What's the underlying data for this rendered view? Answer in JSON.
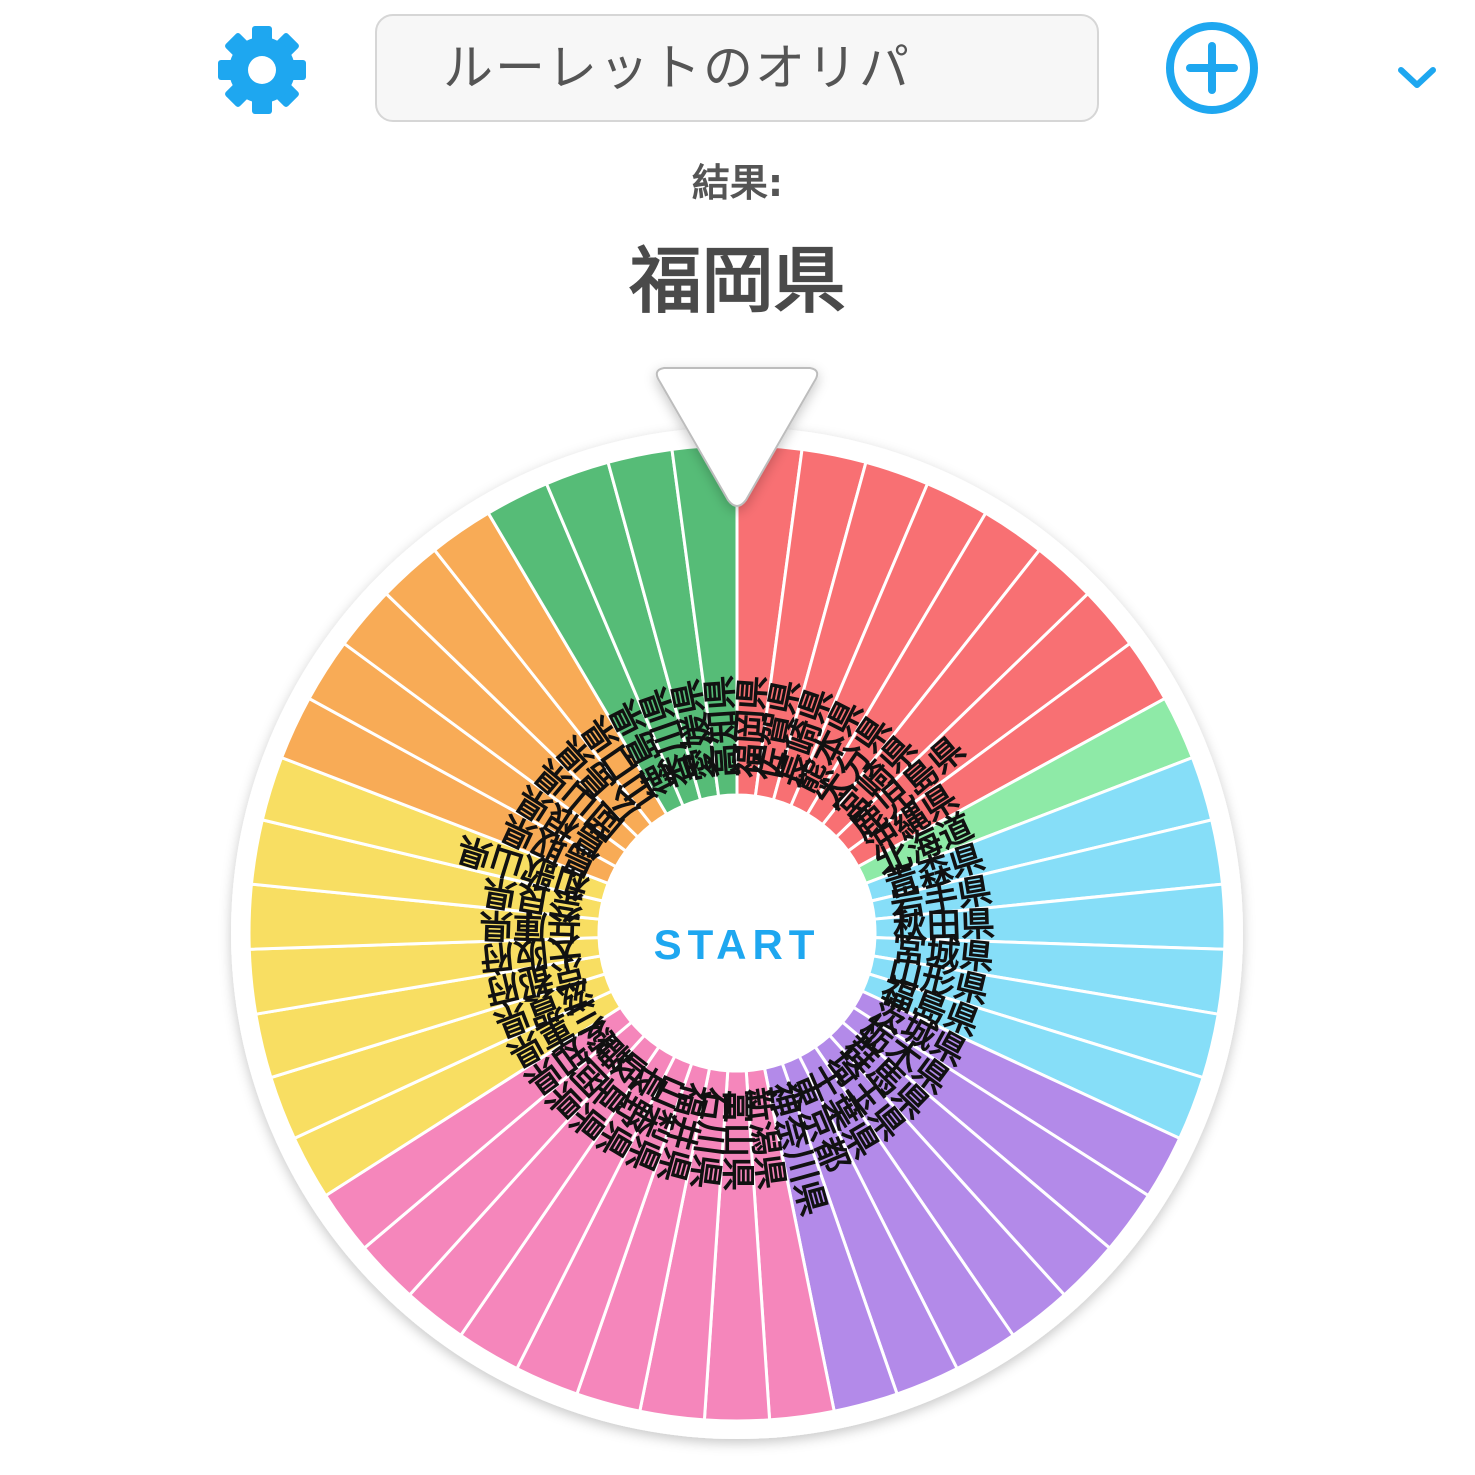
{
  "header": {
    "settings_icon": "gear-icon",
    "roulette_title": "ルーレットのオリパ",
    "dropdown_icon": "chevron-down-icon",
    "add_icon": "plus-circle-icon"
  },
  "result": {
    "label": "結果:",
    "value": "福岡県"
  },
  "wheel": {
    "start_label": "START",
    "pointer_icon": "triangle-pointer-icon",
    "colors": {
      "accent": "#1ea7f0",
      "red": "#f87073",
      "lightgreen": "#8eeaa7",
      "blue": "#86def8",
      "purple": "#b38ae9",
      "pink": "#f586bb",
      "yellow": "#f8de62",
      "orange": "#f8ab56",
      "green": "#56bc77"
    },
    "segments": [
      {
        "label": "福岡県",
        "color": "red"
      },
      {
        "label": "佐賀県",
        "color": "red"
      },
      {
        "label": "長崎県",
        "color": "red"
      },
      {
        "label": "熊本県",
        "color": "red"
      },
      {
        "label": "大分県",
        "color": "red"
      },
      {
        "label": "宮崎県",
        "color": "red"
      },
      {
        "label": "鹿児島県",
        "color": "red"
      },
      {
        "label": "沖縄県",
        "color": "red"
      },
      {
        "label": "北海道",
        "color": "lightgreen"
      },
      {
        "label": "青森県",
        "color": "blue"
      },
      {
        "label": "岩手県",
        "color": "blue"
      },
      {
        "label": "秋田県",
        "color": "blue"
      },
      {
        "label": "宮城県",
        "color": "blue"
      },
      {
        "label": "山形県",
        "color": "blue"
      },
      {
        "label": "福島県",
        "color": "blue"
      },
      {
        "label": "茨城県",
        "color": "purple"
      },
      {
        "label": "栃木県",
        "color": "purple"
      },
      {
        "label": "群馬県",
        "color": "purple"
      },
      {
        "label": "埼玉県",
        "color": "purple"
      },
      {
        "label": "千葉県",
        "color": "purple"
      },
      {
        "label": "東京都",
        "color": "purple"
      },
      {
        "label": "神奈川県",
        "color": "purple"
      },
      {
        "label": "新潟県",
        "color": "pink"
      },
      {
        "label": "富山県",
        "color": "pink"
      },
      {
        "label": "石川県",
        "color": "pink"
      },
      {
        "label": "福井県",
        "color": "pink"
      },
      {
        "label": "山梨県",
        "color": "pink"
      },
      {
        "label": "長野県",
        "color": "pink"
      },
      {
        "label": "岐阜県",
        "color": "pink"
      },
      {
        "label": "静岡県",
        "color": "pink"
      },
      {
        "label": "愛知県",
        "color": "pink"
      },
      {
        "label": "三重県",
        "color": "yellow"
      },
      {
        "label": "滋賀県",
        "color": "yellow"
      },
      {
        "label": "京都府",
        "color": "yellow"
      },
      {
        "label": "大阪府",
        "color": "yellow"
      },
      {
        "label": "兵庫県",
        "color": "yellow"
      },
      {
        "label": "奈良県",
        "color": "yellow"
      },
      {
        "label": "和歌山県",
        "color": "yellow"
      },
      {
        "label": "鳥取県",
        "color": "orange"
      },
      {
        "label": "島根県",
        "color": "orange"
      },
      {
        "label": "岡山県",
        "color": "orange"
      },
      {
        "label": "広島県",
        "color": "orange"
      },
      {
        "label": "山口県",
        "color": "orange"
      },
      {
        "label": "徳島県",
        "color": "green"
      },
      {
        "label": "香川県",
        "color": "green"
      },
      {
        "label": "愛媛県",
        "color": "green"
      },
      {
        "label": "高知県",
        "color": "green"
      }
    ]
  }
}
